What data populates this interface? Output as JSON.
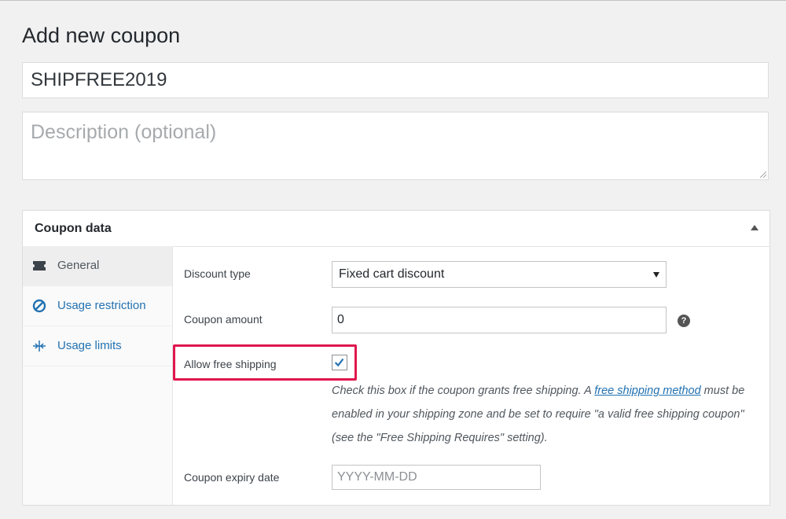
{
  "page": {
    "title": "Add new coupon"
  },
  "coupon": {
    "code_value": "SHIPFREE2019",
    "description_placeholder": "Description (optional)"
  },
  "panel": {
    "title": "Coupon data",
    "tabs": [
      {
        "label": "General",
        "icon": "ticket-icon",
        "active": true
      },
      {
        "label": "Usage restriction",
        "icon": "no-entry-icon",
        "active": false
      },
      {
        "label": "Usage limits",
        "icon": "limits-icon",
        "active": false
      }
    ]
  },
  "fields": {
    "discount_type": {
      "label": "Discount type",
      "value": "Fixed cart discount"
    },
    "coupon_amount": {
      "label": "Coupon amount",
      "value": "0",
      "help": "?"
    },
    "free_shipping": {
      "label": "Allow free shipping",
      "checked": true,
      "desc_before": "Check this box if the coupon grants free shipping. A ",
      "link_text": "free shipping method",
      "desc_after": " must be enabled in your shipping zone and be set to require \"a valid free shipping coupon\" (see the \"Free Shipping Requires\" setting)."
    },
    "expiry_date": {
      "label": "Coupon expiry date",
      "placeholder": "YYYY-MM-DD"
    }
  },
  "colors": {
    "highlight": "#e0174d",
    "link": "#2271b1",
    "checkmark": "#2271b1"
  }
}
